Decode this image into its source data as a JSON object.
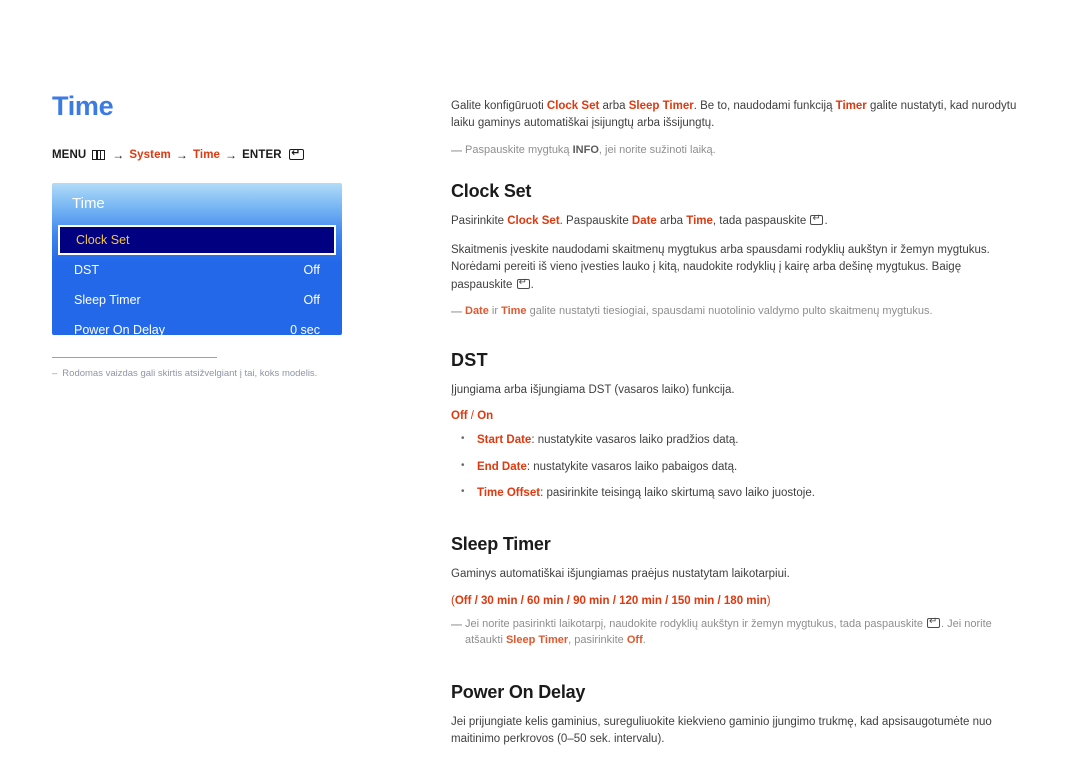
{
  "page": {
    "title": "Time"
  },
  "breadcrumb": {
    "menu_label": "MENU",
    "menu_icon": "menu-grid-icon",
    "arrow": "→",
    "step1": "System",
    "step2": "Time",
    "enter_label": "ENTER",
    "enter_icon": "enter-return-icon"
  },
  "osd": {
    "title": "Time",
    "rows": [
      {
        "label": "Clock Set",
        "value": "",
        "selected": true
      },
      {
        "label": "DST",
        "value": "Off",
        "selected": false
      },
      {
        "label": "Sleep Timer",
        "value": "Off",
        "selected": false
      },
      {
        "label": "Power On Delay",
        "value": "0 sec",
        "selected": false
      }
    ],
    "note_dash": "–",
    "note": "Rodomas vaizdas gali skirtis atsižvelgiant į tai, koks modelis."
  },
  "intro": {
    "t1": "Galite konfigūruoti ",
    "a1": "Clock Set",
    "t2": " arba ",
    "a2": "Sleep Timer",
    "t3": ". Be to, naudodami funkciją ",
    "a3": "Timer",
    "t4": " galite nustatyti, kad nurodytu laiku gaminys automatiškai įsijungtų arba išsijungtų.",
    "note_dash": "—",
    "note_t1": "Paspauskite mygtuką ",
    "note_b1": "INFO",
    "note_t2": ", jei norite sužinoti laiką."
  },
  "clock_set": {
    "heading": "Clock Set",
    "p1_t1": "Pasirinkite ",
    "p1_a1": "Clock Set",
    "p1_t2": ". Paspauskite ",
    "p1_a2": "Date",
    "p1_t3": " arba ",
    "p1_a3": "Time",
    "p1_t4": ", tada paspauskite ",
    "p1_t5": ".",
    "p2_t1": "Skaitmenis įveskite naudodami skaitmenų mygtukus arba spausdami rodyklių aukštyn ir žemyn mygtukus. Norėdami pereiti iš vieno įvesties lauko į kitą, naudokite rodyklių į kairę arba dešinę mygtukus. Baigę paspauskite ",
    "p2_t2": ".",
    "note_dash": "—",
    "note_a1": "Date",
    "note_t1": " ir ",
    "note_a2": "Time",
    "note_t2": " galite nustatyti tiesiogiai, spausdami nuotolinio valdymo pulto skaitmenų mygtukus."
  },
  "dst": {
    "heading": "DST",
    "p1": "Įjungiama arba išjungiama DST (vasaros laiko) funkcija.",
    "options": "Off / On",
    "option_off": "Off",
    "option_sep": " / ",
    "option_on": "On",
    "bullets": [
      {
        "term": "Start Date",
        "desc": ": nustatykite vasaros laiko pradžios datą."
      },
      {
        "term": "End Date",
        "desc": ": nustatykite vasaros laiko pabaigos datą."
      },
      {
        "term": "Time Offset",
        "desc": ": pasirinkite teisingą laiko skirtumą savo laiko juostoje."
      }
    ]
  },
  "sleep_timer": {
    "heading": "Sleep Timer",
    "p1": "Gaminys automatiškai išjungiamas praėjus nustatytam laikotarpiui.",
    "options_open": "(",
    "options_list": "Off / 30 min / 60 min / 90 min / 120 min / 150 min / 180 min",
    "options_close": ")",
    "note_dash": "—",
    "note_t1": "Jei norite pasirinkti laikotarpį, naudokite rodyklių aukštyn ir žemyn mygtukus, tada paspauskite ",
    "note_t2": ". Jei norite atšaukti ",
    "note_a1": "Sleep Timer",
    "note_t3": ", pasirinkite ",
    "note_a2": "Off",
    "note_t4": "."
  },
  "power_on_delay": {
    "heading": "Power On Delay",
    "p1": "Jei prijungiate kelis gaminius, sureguliuokite kiekvieno gaminio įjungimo trukmę, kad apsisaugotumėte nuo maitinimo perkrovos (0–50 sek. intervalu)."
  },
  "colors": {
    "accent": "#e0380f",
    "title_blue": "#3c7ae4",
    "osd_blue": "#2468ea",
    "osd_selected_bg": "#000080",
    "osd_selected_text": "#f5c842"
  }
}
